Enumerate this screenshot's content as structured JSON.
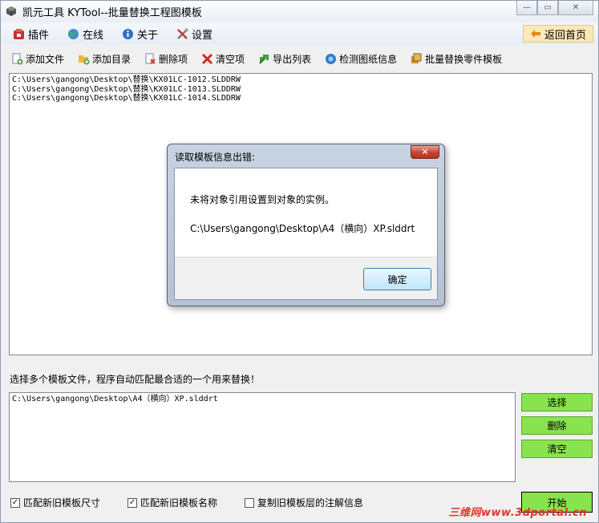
{
  "window": {
    "title": "凯元工具 KYTool--批量替换工程图模板",
    "minimize_glyph": "—",
    "maximize_glyph": "▭",
    "close_glyph": "✕"
  },
  "menu": {
    "items": [
      {
        "label": "插件",
        "icon": "plugin-icon"
      },
      {
        "label": "在线",
        "icon": "globe-icon"
      },
      {
        "label": "关于",
        "icon": "info-icon"
      },
      {
        "label": "设置",
        "icon": "tools-icon"
      }
    ],
    "back_label": "返回首页"
  },
  "toolbar": {
    "items": [
      {
        "label": "添加文件",
        "icon": "add-file-icon"
      },
      {
        "label": "添加目录",
        "icon": "add-folder-icon"
      },
      {
        "label": "删除项",
        "icon": "delete-item-icon"
      },
      {
        "label": "清空项",
        "icon": "clear-icon"
      },
      {
        "label": "导出列表",
        "icon": "export-icon"
      },
      {
        "label": "检测图纸信息",
        "icon": "inspect-icon"
      },
      {
        "label": "批量替换零件模板",
        "icon": "replace-icon"
      }
    ]
  },
  "files": [
    "C:\\Users\\gangong\\Desktop\\替换\\KX01LC-1012.SLDDRW",
    "C:\\Users\\gangong\\Desktop\\替换\\KX01LC-1013.SLDDRW",
    "C:\\Users\\gangong\\Desktop\\替换\\KX01LC-1014.SLDDRW"
  ],
  "template": {
    "hint": "选择多个模板文件，程序自动匹配最合适的一个用来替换！",
    "files": [
      "C:\\Users\\gangong\\Desktop\\A4（横向）XP.slddrt"
    ],
    "select_label": "选择",
    "delete_label": "删除",
    "clear_label": "清空",
    "start_label": "开始"
  },
  "options": [
    {
      "label": "匹配新旧模板尺寸",
      "checked": true
    },
    {
      "label": "匹配新旧模板名称",
      "checked": true
    },
    {
      "label": "复制旧模板层的注解信息",
      "checked": false
    }
  ],
  "dialog": {
    "title": "读取模板信息出错:",
    "message": "未将对象引用设置到对象的实例。",
    "path": "C:\\Users\\gangong\\Desktop\\A4（横向）XP.slddrt",
    "ok_label": "确定",
    "close_glyph": "✕"
  },
  "watermark": "三维网www.3dportal.cn",
  "colors": {
    "accent_green": "#88e34e",
    "back_button": "#fbe8b8",
    "dialog_close": "#c54530"
  }
}
